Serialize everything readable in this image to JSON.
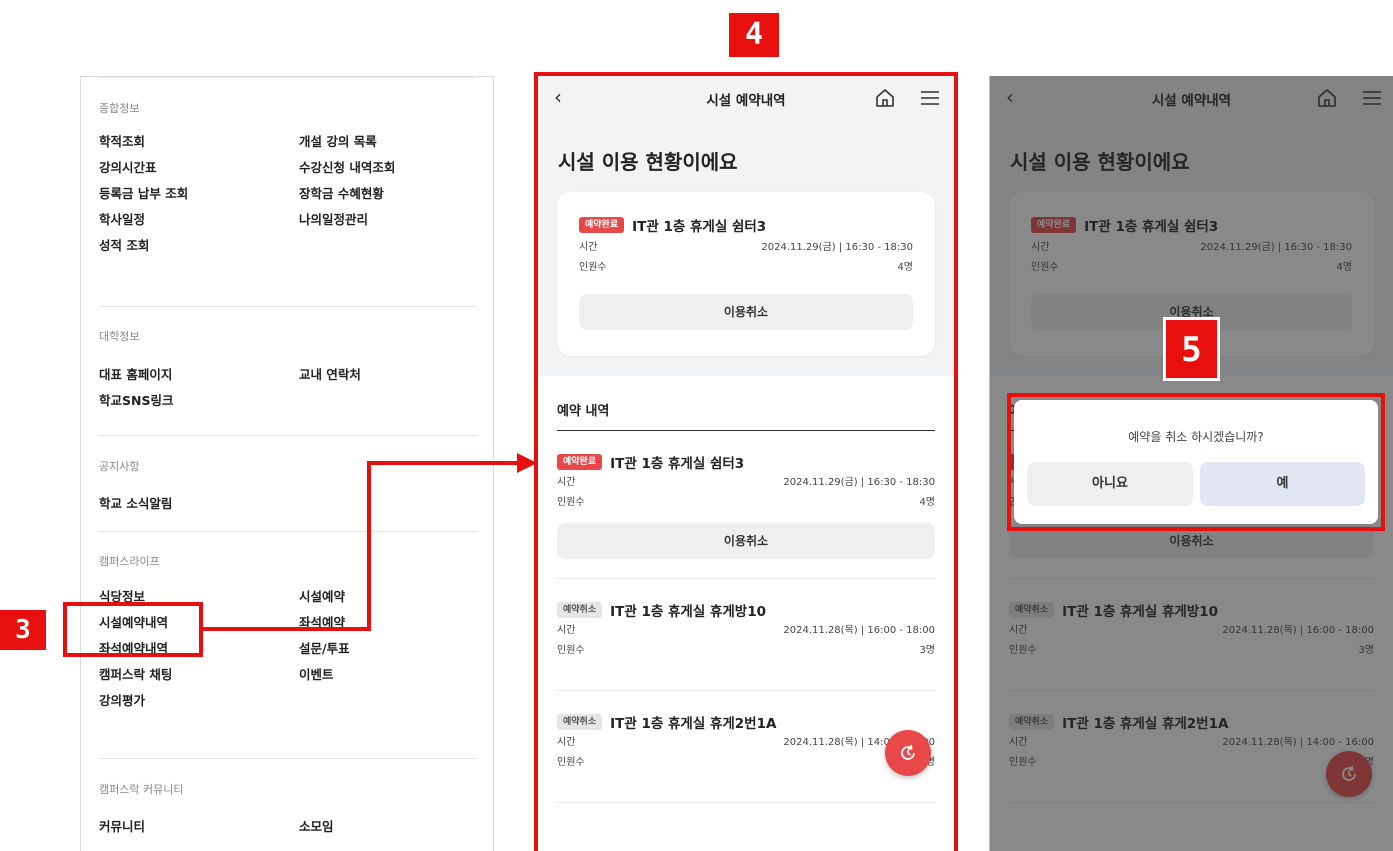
{
  "menu": {
    "sections": [
      {
        "title": "종합정보",
        "items": [
          "학적조회",
          "개설 강의 목록",
          "강의시간표",
          "수강신청 내역조회",
          "등록금 납부 조회",
          "장학금 수혜현황",
          "학사일정",
          "나의일정관리",
          "성적 조회"
        ]
      },
      {
        "title": "대학정보",
        "items": [
          "대표 홈페이지",
          "교내 연락처",
          "학교SNS링크"
        ]
      },
      {
        "title": "공지사항",
        "items": [
          "학교 소식알림"
        ]
      },
      {
        "title": "캠퍼스라이프",
        "items": [
          "식당정보",
          "시설예약",
          "시설예약내역",
          "좌석예약",
          "좌석예약내역",
          "설문/투표",
          "캠퍼스락 채팅",
          "이벤트",
          "강의평가"
        ]
      },
      {
        "title": "캠퍼스락 커뮤니티",
        "items": [
          "커뮤니티",
          "소모임"
        ]
      }
    ]
  },
  "screen": {
    "header_title": "시설 예약내역",
    "back_icon": "chevron-left-icon",
    "hero_title": "시설 이용 현황이에요",
    "current": {
      "badge": "예약완료",
      "name": "IT관 1층 휴게실 쉼터3",
      "time_label": "시간",
      "time_value": "2024.11.29(금) | 16:30 - 18:30",
      "people_label": "인원수",
      "people_value": "4명",
      "cancel_label": "이용취소"
    },
    "list_heading": "예약 내역",
    "reservations": [
      {
        "badge": "예약완료",
        "status": "done",
        "name": "IT관 1층 휴게실 쉼터3",
        "time_label": "시간",
        "time_value": "2024.11.29(금) | 16:30 - 18:30",
        "people_label": "인원수",
        "people_value": "4명",
        "cancel_label": "이용취소"
      },
      {
        "badge": "예약취소",
        "status": "cancel",
        "name": "IT관 1층 휴게실 휴게방10",
        "time_label": "시간",
        "time_value": "2024.11.28(목) | 16:00 - 18:00",
        "people_label": "인원수",
        "people_value": "3명"
      },
      {
        "badge": "예약취소",
        "status": "cancel",
        "name": "IT관 1층 휴게실 휴게2번1A",
        "time_label": "시간",
        "time_value": "2024.11.28(목) | 14:00 - 16:00",
        "people_label": "인원수",
        "people_value": "3명"
      }
    ]
  },
  "dialog": {
    "message": "예약을 취소 하시겠습니까?",
    "no_label": "아니요",
    "yes_label": "예"
  },
  "annotations": {
    "step3": "3",
    "step4": "4",
    "step5": "5",
    "color": "#e8100e"
  },
  "colors": {
    "accent": "#e84848",
    "header_bg": "#f2f3f5",
    "dialog_yes_bg": "#e2e6f2"
  }
}
